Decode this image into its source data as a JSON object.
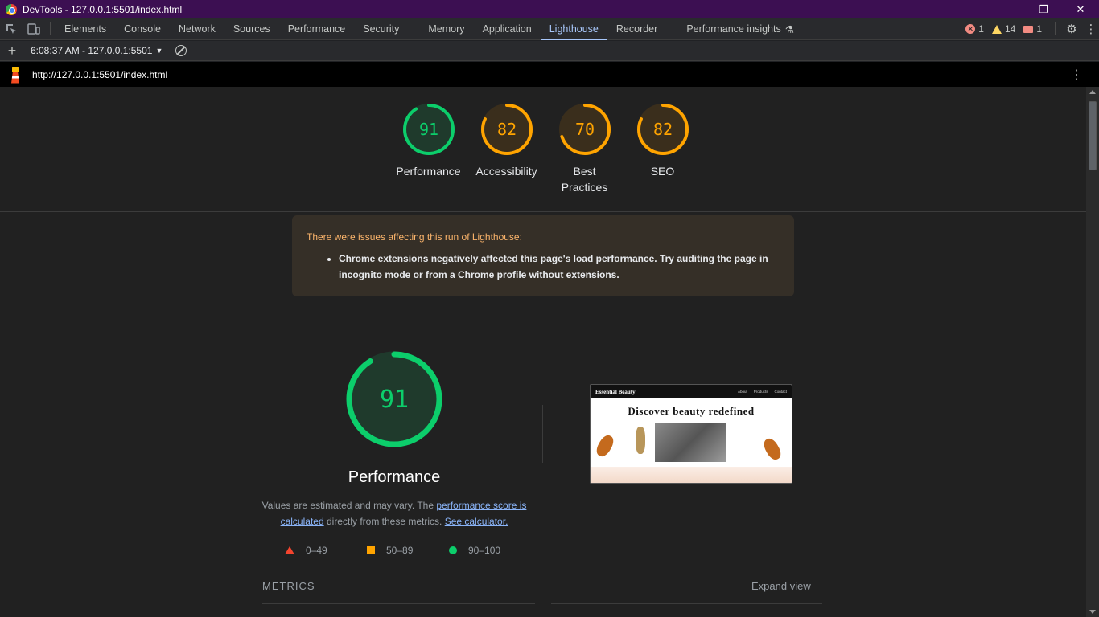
{
  "window": {
    "title": "DevTools - 127.0.0.1:5501/index.html",
    "controls": [
      "—",
      "❐",
      "✕"
    ]
  },
  "tabs": [
    "Elements",
    "Console",
    "Network",
    "Sources",
    "Performance",
    "Security",
    "Memory",
    "Application",
    "Lighthouse",
    "Recorder",
    "Performance insights"
  ],
  "active_tab": "Lighthouse",
  "status": {
    "errors": "1",
    "warnings": "14",
    "issues": "1"
  },
  "toolbar": {
    "report_label": "6:08:37 AM - 127.0.0.1:5501"
  },
  "urlbar": {
    "url": "http://127.0.0.1:5501/index.html"
  },
  "scores": [
    {
      "value": "91",
      "label": "Performance",
      "color": "#0cce6b",
      "fill": 0.91
    },
    {
      "value": "82",
      "label": "Accessibility",
      "color": "#ffa400",
      "fill": 0.82
    },
    {
      "value": "70",
      "label": "Best Practices",
      "color": "#ffa400",
      "fill": 0.7
    },
    {
      "value": "82",
      "label": "SEO",
      "color": "#ffa400",
      "fill": 0.82
    }
  ],
  "warning": {
    "title": "There were issues affecting this run of Lighthouse:",
    "item": "Chrome extensions negatively affected this page's load performance. Try auditing the page in incognito mode or from a Chrome profile without extensions."
  },
  "performance": {
    "score": "91",
    "title": "Performance",
    "desc_prefix": "Values are estimated and may vary. The ",
    "desc_link1": "performance score is calculated",
    "desc_mid": " directly from these metrics. ",
    "desc_link2": "See calculator."
  },
  "legend": [
    "0–49",
    "50–89",
    "90–100"
  ],
  "metrics": {
    "label": "METRICS",
    "expand": "Expand view"
  },
  "thumbnail": {
    "brand": "Essential Beauty",
    "nav": [
      "About",
      "Products",
      "Contact"
    ],
    "headline": "Discover beauty redefined"
  }
}
